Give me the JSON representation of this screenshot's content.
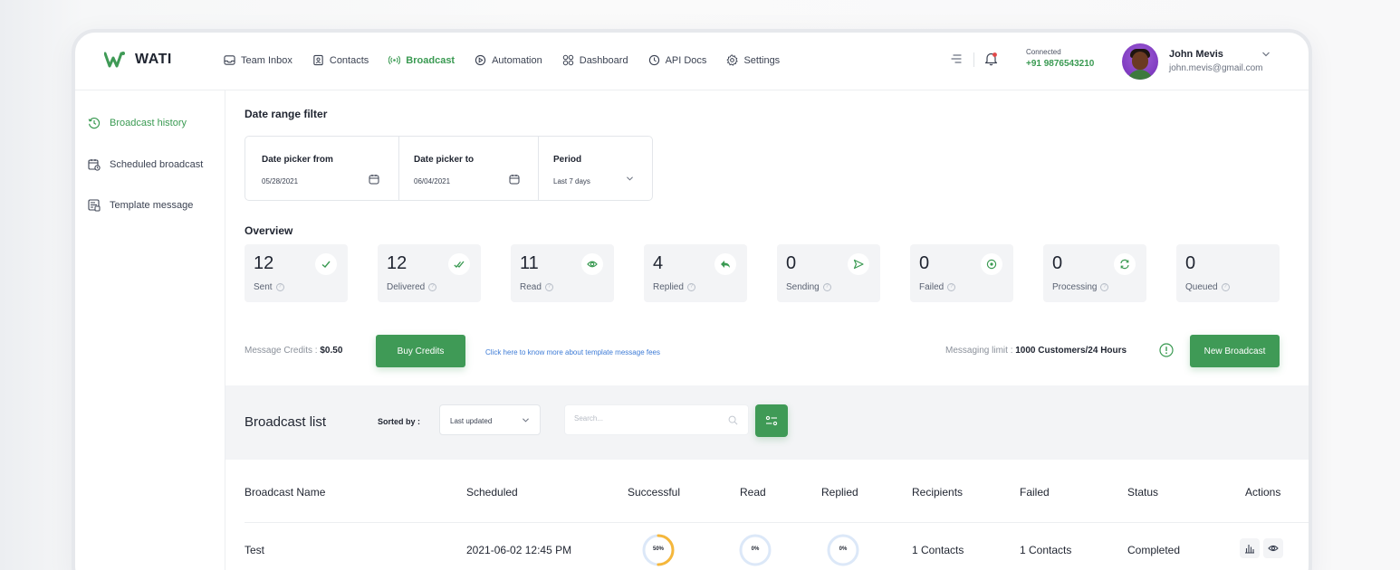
{
  "app": {
    "brand": "WATI"
  },
  "nav": [
    {
      "label": "Team Inbox",
      "icon": "inbox-icon"
    },
    {
      "label": "Contacts",
      "icon": "contacts-icon"
    },
    {
      "label": "Broadcast",
      "icon": "broadcast-icon",
      "active": true
    },
    {
      "label": "Automation",
      "icon": "automation-icon"
    },
    {
      "label": "Dashboard",
      "icon": "dashboard-icon"
    },
    {
      "label": "API Docs",
      "icon": "api-docs-icon"
    },
    {
      "label": "Settings",
      "icon": "gear-icon"
    }
  ],
  "connection": {
    "label": "Connected",
    "phone": "+91 9876543210"
  },
  "user": {
    "name": "John Mevis",
    "email": "john.mevis@gmail.com"
  },
  "sidebar": {
    "items": [
      {
        "label": "Broadcast history",
        "icon": "history-icon",
        "active": true
      },
      {
        "label": "Scheduled broadcast",
        "icon": "calendar-clock-icon"
      },
      {
        "label": "Template message",
        "icon": "template-icon"
      }
    ]
  },
  "filter": {
    "title": "Date range filter",
    "from_label": "Date picker from",
    "from_value": "05/28/2021",
    "to_label": "Date picker to",
    "to_value": "06/04/2021",
    "period_label": "Period",
    "period_value": "Last 7 days"
  },
  "overview": {
    "title": "Overview",
    "stats": [
      {
        "value": "12",
        "label": "Sent",
        "icon": "check-icon"
      },
      {
        "value": "12",
        "label": "Delivered",
        "icon": "double-check-icon"
      },
      {
        "value": "11",
        "label": "Read",
        "icon": "eye-icon"
      },
      {
        "value": "4",
        "label": "Replied",
        "icon": "reply-icon"
      },
      {
        "value": "0",
        "label": "Sending",
        "icon": "send-icon"
      },
      {
        "value": "0",
        "label": "Failed",
        "icon": "failed-icon"
      },
      {
        "value": "0",
        "label": "Processing",
        "icon": "refresh-icon"
      },
      {
        "value": "0",
        "label": "Queued",
        "icon": "none"
      }
    ]
  },
  "credits": {
    "label": "Message Credits :",
    "amount": "$0.50",
    "buy_label": "Buy Credits",
    "fees_link": "Click here to know more about template message fees",
    "limit_label": "Messaging limit :",
    "limit_value": "1000 Customers/24 Hours",
    "new_broadcast_label": "New Broadcast"
  },
  "list": {
    "title": "Broadcast list",
    "sort_label": "Sorted by :",
    "sort_value": "Last updated",
    "search_placeholder": "Search...",
    "columns": [
      "Broadcast Name",
      "Scheduled",
      "Successful",
      "Read",
      "Replied",
      "Recipients",
      "Failed",
      "Status",
      "Actions"
    ],
    "rows": [
      {
        "name": "Test",
        "scheduled": "2021-06-02 12:45 PM",
        "successful": "50%",
        "successful_fraction": 0.5,
        "read": "0%",
        "read_fraction": 0,
        "replied": "0%",
        "replied_fraction": 0,
        "recipients": "1 Contacts",
        "failed": "1 Contacts",
        "status": "Completed"
      }
    ]
  },
  "colors": {
    "accent": "#3f9a56",
    "ring_progress": "#f5b73b",
    "ring_track": "#dce8f8",
    "link": "#3d7bd6"
  }
}
